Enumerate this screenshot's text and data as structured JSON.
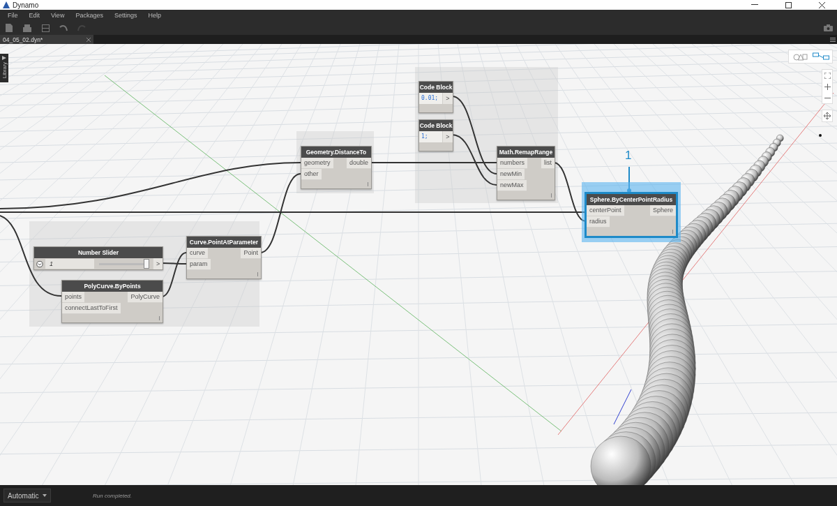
{
  "window": {
    "title": "Dynamo"
  },
  "menu": [
    "File",
    "Edit",
    "View",
    "Packages",
    "Settings",
    "Help"
  ],
  "tabs": [
    {
      "label": "04_05_02.dyn*",
      "selected": true
    }
  ],
  "library": {
    "label": "Library"
  },
  "view_toggle": [
    {
      "kind": "geometry",
      "selected": false
    },
    {
      "kind": "graph",
      "selected": true
    }
  ],
  "nodes": [
    {
      "kind": "function",
      "title": "Geometry.DistanceTo",
      "inputs": [
        "geometry",
        "other"
      ],
      "outputs": [
        "double"
      ],
      "selected": false
    },
    {
      "kind": "code",
      "title": "Code Block",
      "code": "0.01;",
      "outputs": [
        ">"
      ],
      "selected": false
    },
    {
      "kind": "code",
      "title": "Code Block",
      "code": "1;",
      "outputs": [
        ">"
      ],
      "selected": false
    },
    {
      "kind": "function",
      "title": "Math.RemapRange",
      "inputs": [
        "numbers",
        "newMin",
        "newMax"
      ],
      "outputs": [
        "list"
      ],
      "selected": false
    },
    {
      "kind": "slider",
      "title": "Number Slider",
      "value": "1",
      "level": 0.97,
      "outputs": [
        ">"
      ],
      "selected": false
    },
    {
      "kind": "function",
      "title": "Curve.PointAtParameter",
      "inputs": [
        "curve",
        "param"
      ],
      "outputs": [
        "Point"
      ],
      "selected": false
    },
    {
      "kind": "function",
      "title": "PolyCurve.ByPoints",
      "inputs": [
        "points",
        "connectLastToFirst"
      ],
      "outputs": [
        "PolyCurve"
      ],
      "selected": false
    },
    {
      "kind": "function",
      "title": "Sphere.ByCenterPointRadius",
      "inputs": [
        "centerPoint",
        "radius"
      ],
      "outputs": [
        "Sphere"
      ],
      "selected": true
    }
  ],
  "callout": {
    "label": "1"
  },
  "run_mode": {
    "value": "Automatic"
  },
  "status": "Run completed."
}
